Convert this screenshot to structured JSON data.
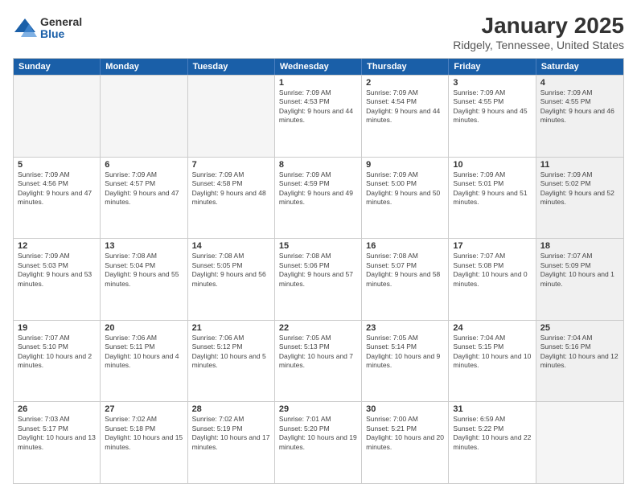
{
  "logo": {
    "general": "General",
    "blue": "Blue"
  },
  "title": "January 2025",
  "subtitle": "Ridgely, Tennessee, United States",
  "days_of_week": [
    "Sunday",
    "Monday",
    "Tuesday",
    "Wednesday",
    "Thursday",
    "Friday",
    "Saturday"
  ],
  "weeks": [
    [
      {
        "day": "",
        "empty": true
      },
      {
        "day": "",
        "empty": true
      },
      {
        "day": "",
        "empty": true
      },
      {
        "day": "1",
        "sunrise": "7:09 AM",
        "sunset": "4:53 PM",
        "daylight": "9 hours and 44 minutes."
      },
      {
        "day": "2",
        "sunrise": "7:09 AM",
        "sunset": "4:54 PM",
        "daylight": "9 hours and 44 minutes."
      },
      {
        "day": "3",
        "sunrise": "7:09 AM",
        "sunset": "4:55 PM",
        "daylight": "9 hours and 45 minutes."
      },
      {
        "day": "4",
        "sunrise": "7:09 AM",
        "sunset": "4:55 PM",
        "daylight": "9 hours and 46 minutes.",
        "shaded": true
      }
    ],
    [
      {
        "day": "5",
        "sunrise": "7:09 AM",
        "sunset": "4:56 PM",
        "daylight": "9 hours and 47 minutes."
      },
      {
        "day": "6",
        "sunrise": "7:09 AM",
        "sunset": "4:57 PM",
        "daylight": "9 hours and 47 minutes."
      },
      {
        "day": "7",
        "sunrise": "7:09 AM",
        "sunset": "4:58 PM",
        "daylight": "9 hours and 48 minutes."
      },
      {
        "day": "8",
        "sunrise": "7:09 AM",
        "sunset": "4:59 PM",
        "daylight": "9 hours and 49 minutes."
      },
      {
        "day": "9",
        "sunrise": "7:09 AM",
        "sunset": "5:00 PM",
        "daylight": "9 hours and 50 minutes."
      },
      {
        "day": "10",
        "sunrise": "7:09 AM",
        "sunset": "5:01 PM",
        "daylight": "9 hours and 51 minutes."
      },
      {
        "day": "11",
        "sunrise": "7:09 AM",
        "sunset": "5:02 PM",
        "daylight": "9 hours and 52 minutes.",
        "shaded": true
      }
    ],
    [
      {
        "day": "12",
        "sunrise": "7:09 AM",
        "sunset": "5:03 PM",
        "daylight": "9 hours and 53 minutes."
      },
      {
        "day": "13",
        "sunrise": "7:08 AM",
        "sunset": "5:04 PM",
        "daylight": "9 hours and 55 minutes."
      },
      {
        "day": "14",
        "sunrise": "7:08 AM",
        "sunset": "5:05 PM",
        "daylight": "9 hours and 56 minutes."
      },
      {
        "day": "15",
        "sunrise": "7:08 AM",
        "sunset": "5:06 PM",
        "daylight": "9 hours and 57 minutes."
      },
      {
        "day": "16",
        "sunrise": "7:08 AM",
        "sunset": "5:07 PM",
        "daylight": "9 hours and 58 minutes."
      },
      {
        "day": "17",
        "sunrise": "7:07 AM",
        "sunset": "5:08 PM",
        "daylight": "10 hours and 0 minutes."
      },
      {
        "day": "18",
        "sunrise": "7:07 AM",
        "sunset": "5:09 PM",
        "daylight": "10 hours and 1 minute.",
        "shaded": true
      }
    ],
    [
      {
        "day": "19",
        "sunrise": "7:07 AM",
        "sunset": "5:10 PM",
        "daylight": "10 hours and 2 minutes."
      },
      {
        "day": "20",
        "sunrise": "7:06 AM",
        "sunset": "5:11 PM",
        "daylight": "10 hours and 4 minutes."
      },
      {
        "day": "21",
        "sunrise": "7:06 AM",
        "sunset": "5:12 PM",
        "daylight": "10 hours and 5 minutes."
      },
      {
        "day": "22",
        "sunrise": "7:05 AM",
        "sunset": "5:13 PM",
        "daylight": "10 hours and 7 minutes."
      },
      {
        "day": "23",
        "sunrise": "7:05 AM",
        "sunset": "5:14 PM",
        "daylight": "10 hours and 9 minutes."
      },
      {
        "day": "24",
        "sunrise": "7:04 AM",
        "sunset": "5:15 PM",
        "daylight": "10 hours and 10 minutes."
      },
      {
        "day": "25",
        "sunrise": "7:04 AM",
        "sunset": "5:16 PM",
        "daylight": "10 hours and 12 minutes.",
        "shaded": true
      }
    ],
    [
      {
        "day": "26",
        "sunrise": "7:03 AM",
        "sunset": "5:17 PM",
        "daylight": "10 hours and 13 minutes."
      },
      {
        "day": "27",
        "sunrise": "7:02 AM",
        "sunset": "5:18 PM",
        "daylight": "10 hours and 15 minutes."
      },
      {
        "day": "28",
        "sunrise": "7:02 AM",
        "sunset": "5:19 PM",
        "daylight": "10 hours and 17 minutes."
      },
      {
        "day": "29",
        "sunrise": "7:01 AM",
        "sunset": "5:20 PM",
        "daylight": "10 hours and 19 minutes."
      },
      {
        "day": "30",
        "sunrise": "7:00 AM",
        "sunset": "5:21 PM",
        "daylight": "10 hours and 20 minutes."
      },
      {
        "day": "31",
        "sunrise": "6:59 AM",
        "sunset": "5:22 PM",
        "daylight": "10 hours and 22 minutes."
      },
      {
        "day": "",
        "empty": true,
        "shaded": true
      }
    ]
  ]
}
